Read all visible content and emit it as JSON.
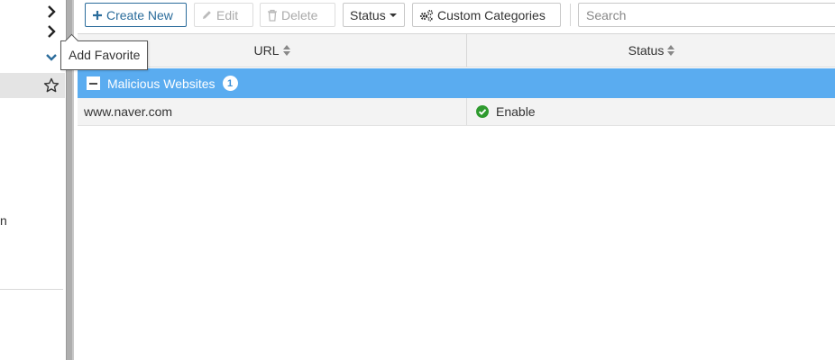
{
  "tooltip": {
    "text": "Add Favorite"
  },
  "sidebar": {
    "partial_label": "n"
  },
  "toolbar": {
    "create_new": "Create New",
    "edit": "Edit",
    "delete": "Delete",
    "status": "Status",
    "custom_categories": "Custom Categories",
    "search_placeholder": "Search"
  },
  "table": {
    "columns": [
      "URL",
      "Status"
    ],
    "group": {
      "name": "Malicious Websites",
      "count": "1"
    },
    "rows": [
      {
        "url": "www.naver.com",
        "status": "Enable"
      }
    ]
  },
  "colors": {
    "accent": "#2b6c9b",
    "group_bg": "#5aacf0",
    "status_ok": "#2e9a2e"
  }
}
